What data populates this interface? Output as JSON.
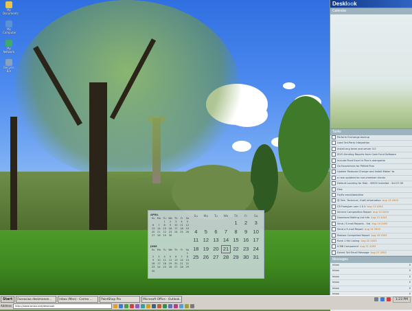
{
  "desktop": {
    "icons": [
      {
        "name": "folder-icon",
        "label": "My Documents",
        "color": "#e7c64a"
      },
      {
        "name": "computer-icon",
        "label": "My Computer",
        "color": "#5b8fd6"
      },
      {
        "name": "network-icon",
        "label": "My Network",
        "color": "#3fa96a"
      },
      {
        "name": "recycle-bin-icon",
        "label": "Recycle Bin",
        "color": "#8aa0c0"
      }
    ]
  },
  "sidebar": {
    "title_parts": [
      "Desk",
      "l",
      "oo",
      "k"
    ],
    "calendar_header": "Calendar",
    "tasks_header": "Tasks",
    "messages_header": "Messages",
    "tasks": [
      {
        "text": "Perform Exchange backup",
        "due": ""
      },
      {
        "text": "Load 3rd-Party Integration",
        "due": ""
      },
      {
        "text": "Install eng team and server 3.0",
        "due": ""
      },
      {
        "text": "ISVO-Sending Reports from Cash Fund Software",
        "due": ""
      },
      {
        "text": "Include Pivot Excel in Plan's stampable",
        "due": ""
      },
      {
        "text": "Go Exactcheck for Pitfeld Pros",
        "due": ""
      },
      {
        "text": "Update 'Reduced Change and Install Maker' to",
        "due": ""
      },
      {
        "text": "a new updated for non-member clients",
        "due": ""
      },
      {
        "text": "Default Locating for Disk - SMCD Installed - 3rd 07:30",
        "due": ""
      },
      {
        "text": "Disk",
        "due": ""
      },
      {
        "text": "Fix/fix email/deadline",
        "due": ""
      },
      {
        "text": "@ Tele. Technical, Graft information",
        "due": "Aug 13 2003"
      },
      {
        "text": "CR Fixes/per user 1.0 0",
        "due": "Aug 13 2003"
      },
      {
        "text": "Service Composition Report",
        "due": "Aug 13 2003"
      },
      {
        "text": "Download Mailing List Info",
        "due": "Aug 13 2003"
      },
      {
        "text": "Send / E-mail Reports - 3rd",
        "due": "Aug 14 2003"
      },
      {
        "text": "Send a E-mail Report",
        "due": "Aug 14 2003"
      },
      {
        "text": "Restore Completed Report",
        "due": "Aug 18 2003"
      },
      {
        "text": "Rank 1 Fall Listing",
        "due": "Aug 20 2003"
      },
      {
        "text": "ICMB Component",
        "due": "Aug 21 2003"
      },
      {
        "text": "Extent Toll Email Message",
        "due": "Aug 22 2003"
      }
    ],
    "messages": [
      {
        "from": "Inbox",
        "count": "0"
      },
      {
        "from": "Inbox",
        "count": "0"
      },
      {
        "from": "Inbox",
        "count": "0"
      },
      {
        "from": "Inbox",
        "count": "0"
      },
      {
        "from": "Inbox",
        "count": "0"
      },
      {
        "from": "Inbox",
        "count": "0"
      },
      {
        "from": "Inbox",
        "count": "0"
      }
    ]
  },
  "calendar_widget": {
    "mini_months": [
      {
        "title": "APRIL",
        "days": [
          "",
          "",
          "1",
          "2",
          "3",
          "4",
          "5",
          "6",
          "7",
          "8",
          "9",
          "10",
          "11",
          "12",
          "13",
          "14",
          "15",
          "16",
          "17",
          "18",
          "19",
          "20",
          "21",
          "22",
          "23",
          "24",
          "25",
          "26",
          "27",
          "28",
          "29",
          "30",
          "",
          "",
          "",
          ""
        ]
      },
      {
        "title": "JUNE",
        "days": [
          "",
          "",
          "",
          "",
          "",
          "",
          "1",
          "2",
          "3",
          "4",
          "5",
          "6",
          "7",
          "8",
          "9",
          "10",
          "11",
          "12",
          "13",
          "14",
          "15",
          "16",
          "17",
          "18",
          "19",
          "20",
          "21",
          "22",
          "23",
          "24",
          "25",
          "26",
          "27",
          "28",
          "29",
          "30"
        ]
      }
    ],
    "weekdays": [
      "Su",
      "Mo",
      "Tu",
      "We",
      "Th",
      "Fr",
      "Sa"
    ],
    "days": [
      "",
      "",
      "",
      "",
      "1",
      "2",
      "3",
      "4",
      "5",
      "6",
      "7",
      "8",
      "9",
      "10",
      "11",
      "12",
      "13",
      "14",
      "15",
      "16",
      "17",
      "18",
      "19",
      "20",
      "21",
      "22",
      "23",
      "24",
      "25",
      "26",
      "27",
      "28",
      "29",
      "30",
      "31"
    ],
    "today": "21"
  },
  "taskbar": {
    "start_label": "Start",
    "windows": [
      "Faceasiaa deskmanon...",
      "Inbox (Mon) - Correo ...",
      "PaintShop Pro",
      "Microsoft Office - Outlook..."
    ],
    "address_label": "Address",
    "address_value": "http://www.anizo.net/desklook",
    "clock": "1:23 PM",
    "quick_launch_colors": [
      "#e0a030",
      "#3a7ad6",
      "#44a040",
      "#d04040",
      "#8a5ad0",
      "#30a0a0",
      "#d0a020",
      "#406080",
      "#c06030",
      "#2f8f4f",
      "#6070c0",
      "#b04080",
      "#50a0d0",
      "#a0a030",
      "#7a7a7a"
    ]
  }
}
